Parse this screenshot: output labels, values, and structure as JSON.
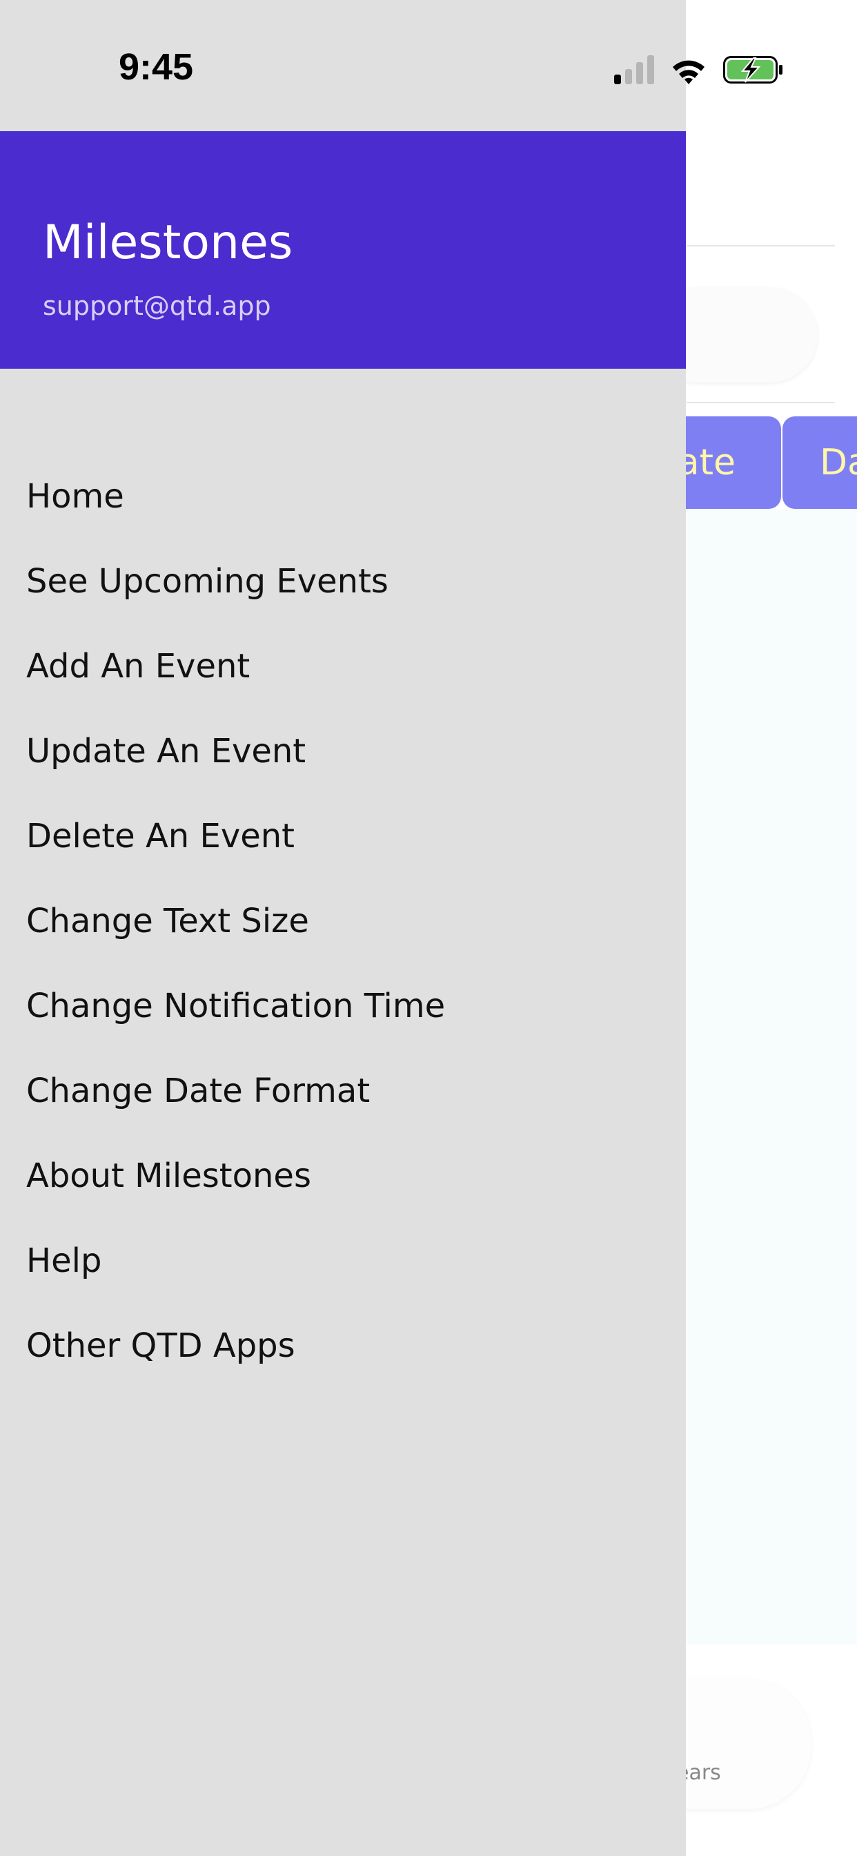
{
  "status_bar": {
    "time": "9:45",
    "icons": [
      "cellular-signal-icon",
      "wifi-icon",
      "battery-charging-icon"
    ]
  },
  "drawer": {
    "title": "Milestones",
    "email": "support@qtd.app",
    "items": [
      {
        "label": "Home"
      },
      {
        "label": "See Upcoming Events"
      },
      {
        "label": "Add An Event"
      },
      {
        "label": "Update An Event"
      },
      {
        "label": "Delete An Event"
      },
      {
        "label": "Change Text Size"
      },
      {
        "label": "Change Notification Time"
      },
      {
        "label": "Change Date Format"
      },
      {
        "label": "About Milestones"
      },
      {
        "label": "Help"
      },
      {
        "label": "Other QTD Apps"
      }
    ]
  },
  "background": {
    "tab_1_partial": "ate",
    "tab_2_partial": "Da",
    "bottom_partial": "ears"
  },
  "colors": {
    "drawer_header": "#4b2ccf",
    "drawer_bg": "#e0e0e0",
    "tab_bg": "#7f7ff4",
    "tab_text": "#fff6a8",
    "battery_fill": "#63c15a"
  }
}
